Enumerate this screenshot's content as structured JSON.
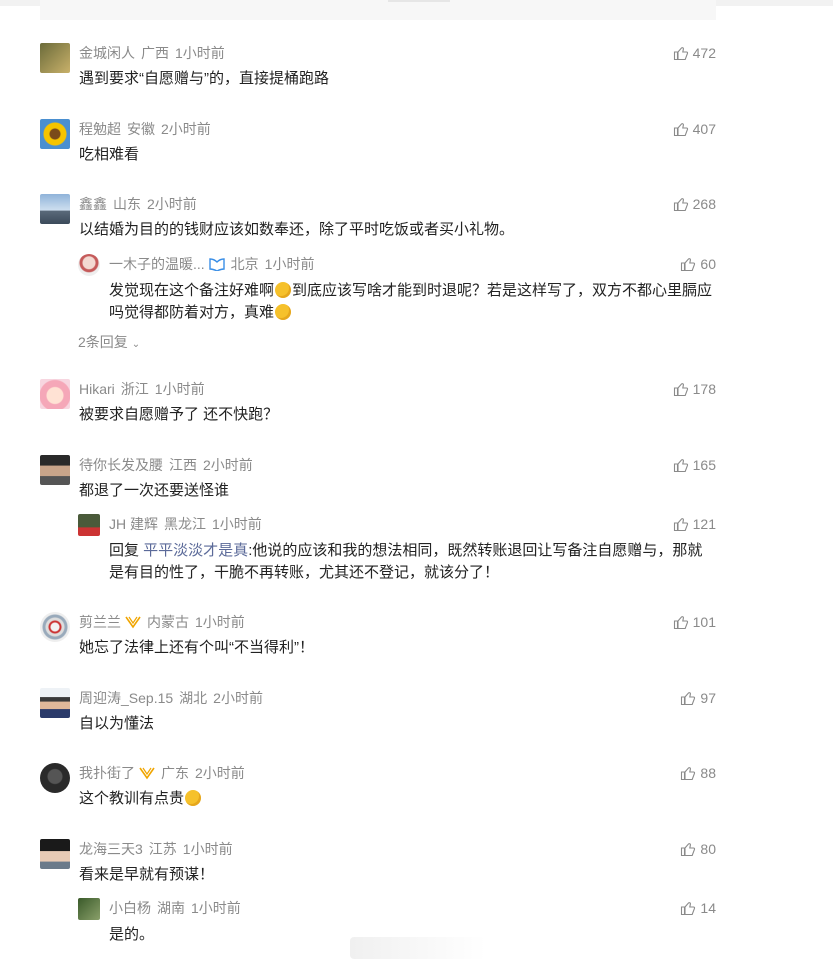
{
  "comments": [
    {
      "user": "金城闲人",
      "region": "广西",
      "time": "1小时前",
      "likes": "472",
      "text": "遇到要求“自愿赠与”的，直接提桶跑路"
    },
    {
      "user": "程勉超",
      "region": "安徽",
      "time": "2小时前",
      "likes": "407",
      "text": "吃相难看"
    },
    {
      "user": "鑫鑫",
      "region": "山东",
      "time": "2小时前",
      "likes": "268",
      "text": "以结婚为目的的钱财应该如数奉还，除了平时吃饭或者买小礼物。",
      "reply": {
        "user": "一木子的温暖...",
        "region": "北京",
        "time": "1小时前",
        "likes": "60",
        "text_line1_a": "发觉现在这个备注好难啊",
        "text_line1_b": "到底应该写啥才能到时退呢？若是这样写了，双方不都心里膈应",
        "text_line2": "吗觉得都防着对方，真难"
      },
      "more": "2条回复"
    },
    {
      "user": "Hikari",
      "region": "浙江",
      "time": "1小时前",
      "likes": "178",
      "text": "被要求自愿赠予了 还不快跑？"
    },
    {
      "user": "待你长发及腰",
      "region": "江西",
      "time": "2小时前",
      "likes": "165",
      "text": "都退了一次还要送怪谁",
      "reply": {
        "user": "JH 建辉",
        "region": "黑龙江",
        "time": "1小时前",
        "likes": "121",
        "prefix": "回复 ",
        "mention": "平平淡淡才是真",
        "text_line1": ":他说的应该和我的想法相同，既然转账退回让写备注自愿赠与，那就",
        "text_line2": "是有目的性了，干脆不再转账，尤其还不登记，就该分了！"
      }
    },
    {
      "user": "剪兰兰",
      "region": "内蒙古",
      "time": "1小时前",
      "likes": "101",
      "text": "她忘了法律上还有个叫“不当得利”！"
    },
    {
      "user": "周迎涛_Sep.15",
      "region": "湖北",
      "time": "2小时前",
      "likes": "97",
      "text": "自以为懂法"
    },
    {
      "user": "我扑街了",
      "region": "广东",
      "time": "2小时前",
      "likes": "88",
      "text": "这个教训有点贵"
    },
    {
      "user": "龙海三天3",
      "region": "江苏",
      "time": "1小时前",
      "likes": "80",
      "text": "看来是早就有预谋！",
      "reply": {
        "user": "小白杨",
        "region": "湖南",
        "time": "1小时前",
        "likes": "14",
        "text": "是的。"
      }
    }
  ],
  "colors": {
    "meta": "#8a8a8a",
    "text": "#222222",
    "mention": "#5b6a99",
    "badge": "#f0a500"
  }
}
